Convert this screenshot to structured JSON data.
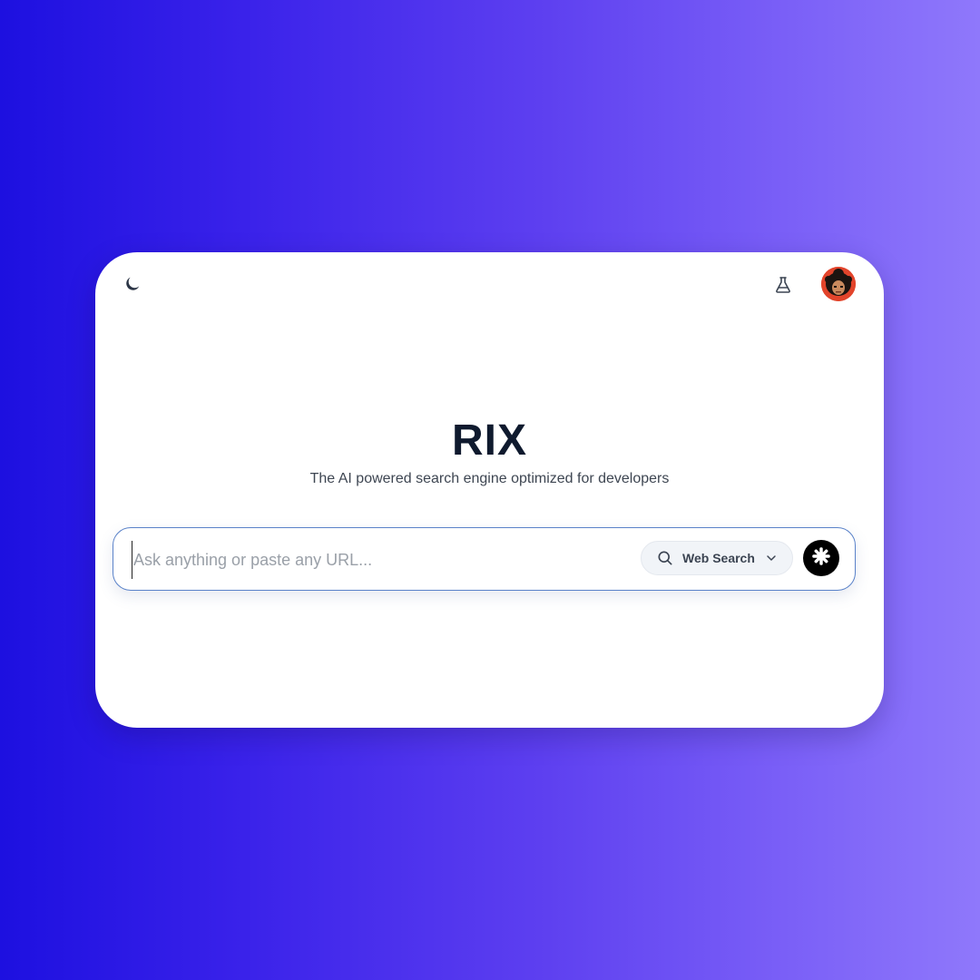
{
  "app": {
    "logo": "RIX",
    "tagline": "The AI powered search engine optimized for developers"
  },
  "header": {
    "theme_icon": "moon-icon",
    "labs_icon": "flask-icon",
    "avatar_icon": "user-avatar"
  },
  "search": {
    "placeholder": "Ask anything or paste any URL...",
    "value": "",
    "mode_label": "Web Search",
    "mode_icon": "search-icon",
    "dropdown_icon": "chevron-down-icon",
    "submit_icon": "asterisk-icon"
  },
  "colors": {
    "background_start": "#1d10e0",
    "background_end": "#8f78fb",
    "text_dark": "#0f1a2e",
    "focus_border": "#5a82c9",
    "avatar_bg": "#e2442b"
  }
}
